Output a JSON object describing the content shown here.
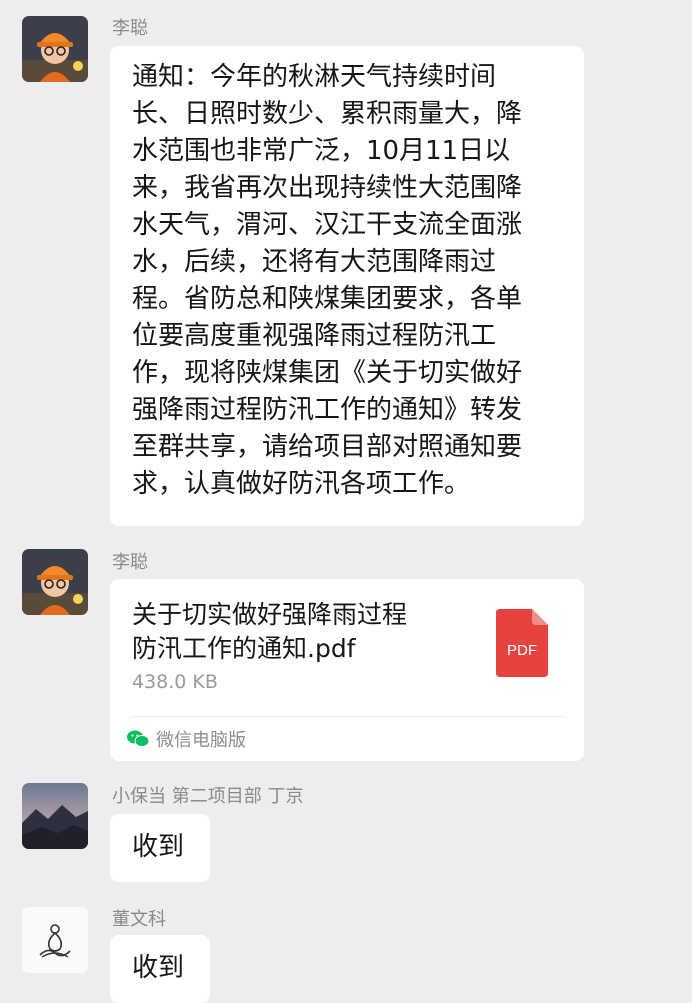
{
  "messages": [
    {
      "sender": "李聪",
      "avatar": "cartoon-engineer-avatar",
      "type": "text",
      "text": "通知：今年的秋淋天气持续时间\n长、日照时数少、累积雨量大，降\n水范围也非常广泛，10月11日以\n来，我省再次出现持续性大范围降\n水天气，渭河、汉江干支流全面涨\n水，后续，还将有大范围降雨过\n程。省防总和陕煤集团要求，各单\n位要高度重视强降雨过程防汛工\n作，现将陕煤集团《关于切实做好\n强降雨过程防汛工作的通知》转发\n至群共享，请给项目部对照通知要\n求，认真做好防汛各项工作。"
    },
    {
      "sender": "李聪",
      "avatar": "cartoon-engineer-avatar",
      "type": "file",
      "file_name": "关于切实做好强降雨过程\n防汛工作的通知.pdf",
      "file_size": "438.0 KB",
      "file_badge": "PDF",
      "source": "微信电脑版",
      "source_icon": "wechat-icon"
    },
    {
      "sender": "小保当 第二项目部 丁京",
      "avatar": "landscape-avatar",
      "type": "text",
      "text": "收到"
    },
    {
      "sender": "董文科",
      "avatar": "meditation-avatar",
      "type": "text",
      "text": "收到"
    }
  ],
  "colors": {
    "background": "#ededed",
    "bubble": "#ffffff",
    "pdf_red": "#e64340",
    "wechat_green": "#07c160"
  }
}
